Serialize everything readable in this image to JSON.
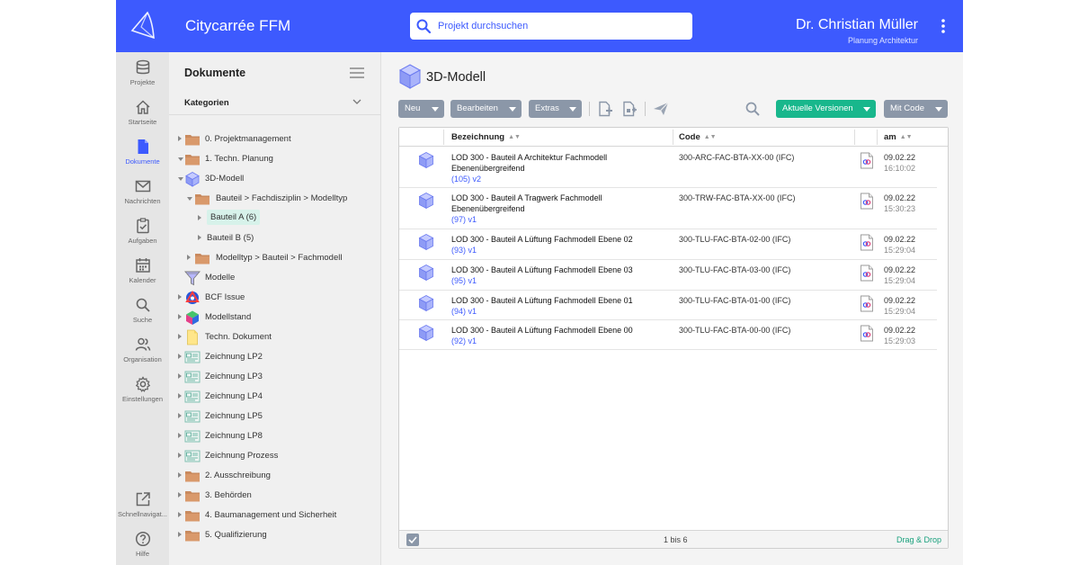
{
  "header": {
    "app_title": "Citycarrée FFM",
    "search_placeholder": "Projekt durchsuchen",
    "user_name": "Dr. Christian Müller",
    "user_role": "Planung Architektur",
    "accent": "#3d5afe"
  },
  "nav": [
    {
      "label": "Projekte",
      "icon": "database-icon"
    },
    {
      "label": "Startseite",
      "icon": "home-icon"
    },
    {
      "label": "Dokumente",
      "icon": "document-icon",
      "active": true
    },
    {
      "label": "Nachrichten",
      "icon": "mail-icon"
    },
    {
      "label": "Aufgaben",
      "icon": "task-icon"
    },
    {
      "label": "Kalender",
      "icon": "calendar-icon"
    },
    {
      "label": "Suche",
      "icon": "search-icon"
    },
    {
      "label": "Organisation",
      "icon": "people-icon"
    },
    {
      "label": "Einstellungen",
      "icon": "gear-icon"
    },
    {
      "label": "Schnellnavigat...",
      "icon": "external-link-icon"
    },
    {
      "label": "Hilfe",
      "icon": "help-icon"
    }
  ],
  "tree": {
    "title": "Dokumente",
    "category_label": "Kategorien",
    "nodes": [
      {
        "label": "0. Projektmanagement",
        "icon": "folder-icon"
      },
      {
        "label": "1. Techn. Planung",
        "icon": "folder-icon",
        "expanded": true
      },
      {
        "label": "3D-Modell",
        "icon": "cube-icon",
        "expanded": true
      },
      {
        "label": "Bauteil > Fachdisziplin > Modelltyp",
        "icon": "folder-icon",
        "expanded": true
      },
      {
        "label": "Bauteil A (6)",
        "icon": "",
        "selected": true
      },
      {
        "label": "Bauteil B (5)",
        "icon": ""
      },
      {
        "label": "Modelltyp > Bauteil > Fachmodell",
        "icon": "folder-icon"
      },
      {
        "label": "Modelle",
        "icon": "filter-icon"
      },
      {
        "label": "BCF Issue",
        "icon": "bcf-icon"
      },
      {
        "label": "Modellstand",
        "icon": "color-cube-icon"
      },
      {
        "label": "Techn. Dokument",
        "icon": "yellow-doc-icon"
      },
      {
        "label": "Zeichnung LP2",
        "icon": "drawing-icon"
      },
      {
        "label": "Zeichnung LP3",
        "icon": "drawing-icon"
      },
      {
        "label": "Zeichnung LP4",
        "icon": "drawing-icon"
      },
      {
        "label": "Zeichnung LP5",
        "icon": "drawing-icon"
      },
      {
        "label": "Zeichnung LP8",
        "icon": "drawing-icon"
      },
      {
        "label": "Zeichnung Prozess",
        "icon": "drawing-icon"
      },
      {
        "label": "2. Ausschreibung",
        "icon": "folder-icon"
      },
      {
        "label": "3. Behörden",
        "icon": "folder-icon"
      },
      {
        "label": "4. Baumanagement und Sicherheit",
        "icon": "folder-icon"
      },
      {
        "label": "5. Qualifizierung",
        "icon": "folder-icon"
      }
    ]
  },
  "main": {
    "title": "3D-Modell",
    "toolbar": {
      "new": "Neu",
      "edit": "Bearbeiten",
      "extras": "Extras",
      "versions": "Aktuelle Versionen",
      "with_code": "Mit Code"
    },
    "columns": {
      "name": "Bezeichnung",
      "code": "Code",
      "date": "am"
    },
    "rows": [
      {
        "name": "LOD 300 - Bauteil A Architektur Fachmodell Ebenenübergreifend",
        "version": "(105) v2",
        "code": "300-ARC-FAC-BTA-XX-00 (IFC)",
        "date": "09.02.22",
        "time": "16:10:02"
      },
      {
        "name": "LOD 300 - Bauteil A Tragwerk Fachmodell Ebenenübergreifend",
        "version": "(97) v1",
        "code": "300-TRW-FAC-BTA-XX-00 (IFC)",
        "date": "09.02.22",
        "time": "15:30:23"
      },
      {
        "name": "LOD 300 - Bauteil A Lüftung Fachmodell Ebene 02",
        "version": "(93) v1",
        "code": "300-TLU-FAC-BTA-02-00 (IFC)",
        "date": "09.02.22",
        "time": "15:29:04"
      },
      {
        "name": "LOD 300 - Bauteil A Lüftung Fachmodell Ebene 03",
        "version": "(95) v1",
        "code": "300-TLU-FAC-BTA-03-00 (IFC)",
        "date": "09.02.22",
        "time": "15:29:04"
      },
      {
        "name": "LOD 300 - Bauteil A Lüftung Fachmodell Ebene 01",
        "version": "(94) v1",
        "code": "300-TLU-FAC-BTA-01-00 (IFC)",
        "date": "09.02.22",
        "time": "15:29:04"
      },
      {
        "name": "LOD 300 - Bauteil A Lüftung Fachmodell Ebene 00",
        "version": "(92) v1",
        "code": "300-TLU-FAC-BTA-00-00 (IFC)",
        "date": "09.02.22",
        "time": "15:29:03"
      }
    ],
    "footer": {
      "count": "1 bis 6",
      "drag_drop": "Drag & Drop"
    }
  }
}
